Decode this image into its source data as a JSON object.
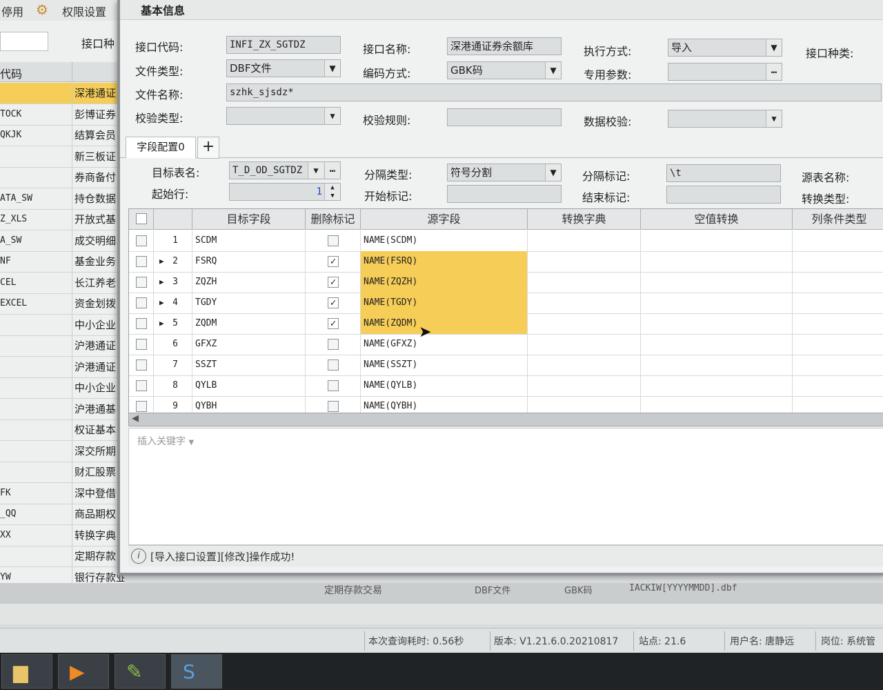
{
  "bg": {
    "toolbar": {
      "stop": "停用",
      "perm": "权限设置"
    },
    "search_label": "接口种",
    "col_header": "代码",
    "rows": [
      {
        "code": "",
        "name": "深港通证"
      },
      {
        "code": "TOCK",
        "name": "彭博证券"
      },
      {
        "code": "QKJK",
        "name": "结算会员"
      },
      {
        "code": "",
        "name": "新三板证"
      },
      {
        "code": "",
        "name": "券商备付"
      },
      {
        "code": "ATA_SW",
        "name": "持仓数据"
      },
      {
        "code": "Z_XLS",
        "name": "开放式基"
      },
      {
        "code": "A_SW",
        "name": "成交明细"
      },
      {
        "code": "NF",
        "name": "基金业务"
      },
      {
        "code": "CEL",
        "name": "长江养老"
      },
      {
        "code": "EXCEL",
        "name": "资金划拨"
      },
      {
        "code": "",
        "name": "中小企业"
      },
      {
        "code": "",
        "name": "沪港通证"
      },
      {
        "code": "",
        "name": "沪港通证"
      },
      {
        "code": "",
        "name": "中小企业"
      },
      {
        "code": "",
        "name": "沪港通基"
      },
      {
        "code": "",
        "name": "权证基本"
      },
      {
        "code": "",
        "name": "深交所期"
      },
      {
        "code": "",
        "name": "财汇股票"
      },
      {
        "code": "FK",
        "name": "深中登借"
      },
      {
        "code": "_QQ",
        "name": "商品期权"
      },
      {
        "code": "XX",
        "name": "转换字典"
      },
      {
        "code": "",
        "name": "定期存款"
      },
      {
        "code": "YW",
        "name": "银行存款业务"
      }
    ],
    "bottom_row": {
      "c1": "定期存款交易",
      "c2": "DBF文件",
      "c3": "GBK码",
      "c4": "IACKIW[YYYYMMDD].dbf"
    }
  },
  "dialog": {
    "section_title": "基本信息",
    "labels": {
      "if_code": "接口代码:",
      "if_name": "接口名称:",
      "exec_mode": "执行方式:",
      "if_kind": "接口种类:",
      "file_type": "文件类型:",
      "encoding": "编码方式:",
      "special_param": "专用参数:",
      "file_name": "文件名称:",
      "verify_type": "校验类型:",
      "verify_rule": "校验规则:",
      "data_verify": "数据校验:"
    },
    "values": {
      "if_code": "INFI_ZX_SGTDZ",
      "if_name": "深港通证券余额库",
      "exec_mode": "导入",
      "file_type": "DBF文件",
      "encoding": "GBK码",
      "special_param": "",
      "file_name": "szhk_sjsdz*",
      "verify_type": "",
      "verify_rule": "",
      "data_verify": ""
    },
    "tabs": {
      "tab0": "字段配置0",
      "add": "+"
    },
    "config": {
      "labels": {
        "target_table": "目标表名:",
        "start_row": "起始行:",
        "sep_type": "分隔类型:",
        "start_mark": "开始标记:",
        "sep_mark": "分隔标记:",
        "end_mark": "结束标记:",
        "src_table": "源表名称:",
        "conv_type": "转换类型:"
      },
      "values": {
        "target_table": "T_D_OD_SGTDZ",
        "start_row": "1",
        "sep_type": "符号分割",
        "sep_mark": "\\t"
      }
    },
    "grid": {
      "headers": {
        "target_field": "目标字段",
        "delete_mark": "删除标记",
        "source_field": "源字段",
        "conv_dict": "转换字典",
        "null_conv": "空值转换",
        "col_cond_type": "列条件类型"
      },
      "rows": [
        {
          "no": "1",
          "field": "SCDM",
          "deleted": false,
          "src": "NAME(SCDM)",
          "hl": false,
          "arrow": false
        },
        {
          "no": "2",
          "field": "FSRQ",
          "deleted": true,
          "src": "NAME(FSRQ)",
          "hl": true,
          "arrow": true
        },
        {
          "no": "3",
          "field": "ZQZH",
          "deleted": true,
          "src": "NAME(ZQZH)",
          "hl": true,
          "arrow": true
        },
        {
          "no": "4",
          "field": "TGDY",
          "deleted": true,
          "src": "NAME(TGDY)",
          "hl": true,
          "arrow": true
        },
        {
          "no": "5",
          "field": "ZQDM",
          "deleted": true,
          "src": "NAME(ZQDM)",
          "hl": true,
          "arrow": true
        },
        {
          "no": "6",
          "field": "GFXZ",
          "deleted": false,
          "src": "NAME(GFXZ)",
          "hl": false,
          "arrow": false
        },
        {
          "no": "7",
          "field": "SSZT",
          "deleted": false,
          "src": "NAME(SSZT)",
          "hl": false,
          "arrow": false
        },
        {
          "no": "8",
          "field": "QYLB",
          "deleted": false,
          "src": "NAME(QYLB)",
          "hl": false,
          "arrow": false
        },
        {
          "no": "9",
          "field": "QYBH",
          "deleted": false,
          "src": "NAME(QYBH)",
          "hl": false,
          "arrow": false
        }
      ],
      "highlight_color": "#f5cd57"
    },
    "insert_keyword": "插入关键字",
    "message": "[导入接口设置][修改]操作成功!"
  },
  "statusbar": {
    "query_time": "本次查询耗时: 0.56秒",
    "version": "版本: V1.21.6.0.20210817",
    "site": "站点: 21.6",
    "user": "用户名: 唐静远",
    "post": "岗位: 系统管"
  }
}
